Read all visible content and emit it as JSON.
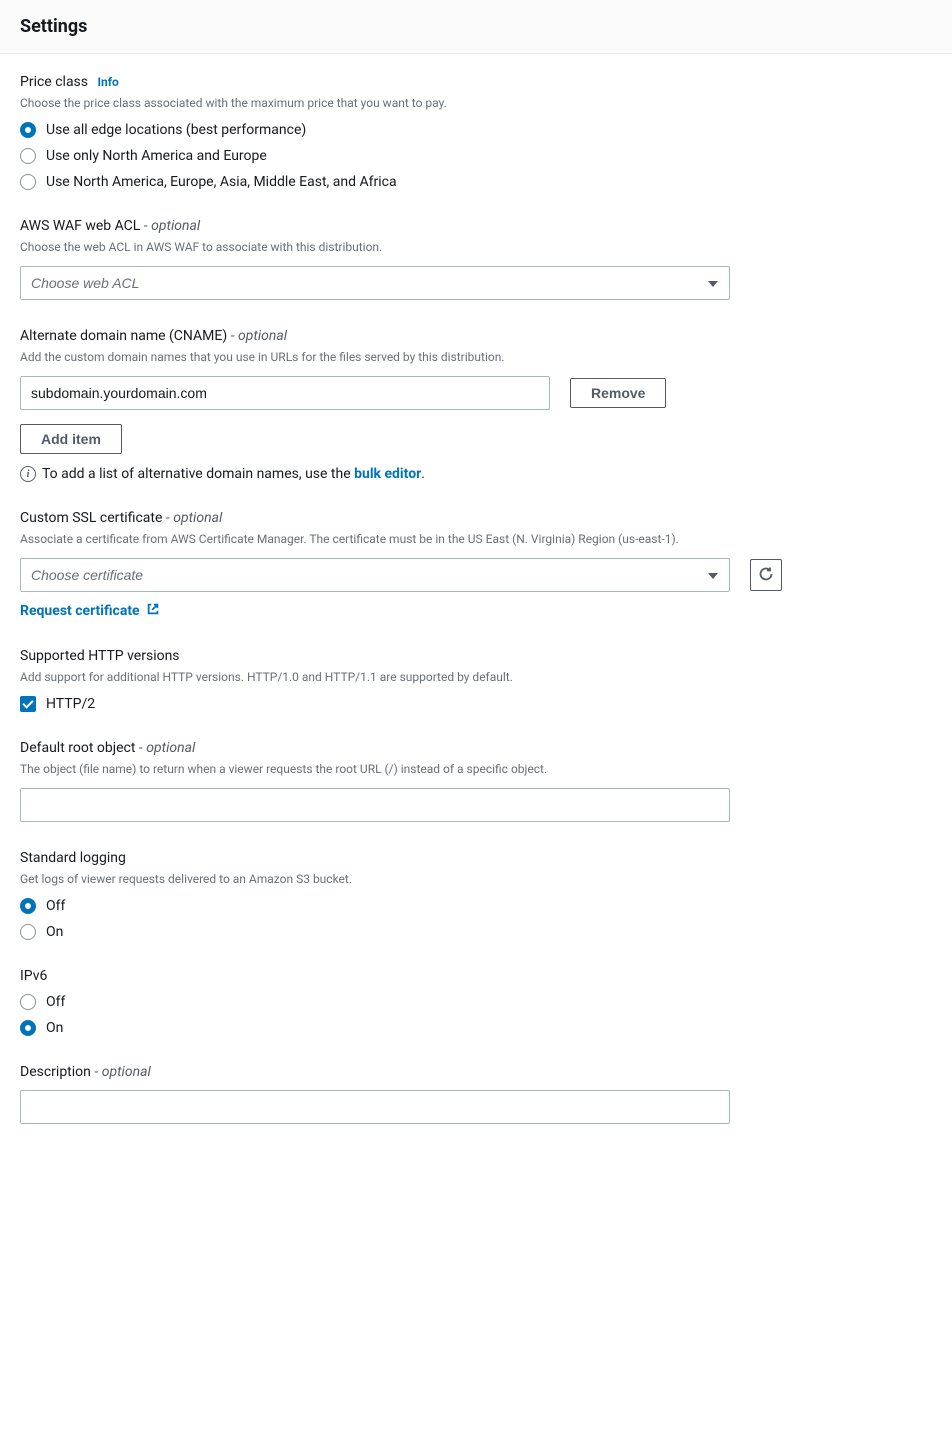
{
  "header": {
    "title": "Settings"
  },
  "priceClass": {
    "label": "Price class",
    "infoLink": "Info",
    "description": "Choose the price class associated with the maximum price that you want to pay.",
    "options": [
      {
        "label": "Use all edge locations (best performance)",
        "checked": true
      },
      {
        "label": "Use only North America and Europe",
        "checked": false
      },
      {
        "label": "Use North America, Europe, Asia, Middle East, and Africa",
        "checked": false
      }
    ]
  },
  "wafAcl": {
    "label": "AWS WAF web ACL",
    "optional": "optional",
    "description": "Choose the web ACL in AWS WAF to associate with this distribution.",
    "placeholder": "Choose web ACL"
  },
  "cname": {
    "label": "Alternate domain name (CNAME)",
    "optional": "optional",
    "description": "Add the custom domain names that you use in URLs for the files served by this distribution.",
    "value": "subdomain.yourdomain.com",
    "removeLabel": "Remove",
    "addItemLabel": "Add item",
    "infoText": "To add a list of alternative domain names, use the ",
    "bulkEditorLink": "bulk editor",
    "period": "."
  },
  "sslCert": {
    "label": "Custom SSL certificate",
    "optional": "optional",
    "description": "Associate a certificate from AWS Certificate Manager. The certificate must be in the US East (N. Virginia) Region (us-east-1).",
    "placeholder": "Choose certificate",
    "requestLink": "Request certificate"
  },
  "httpVersions": {
    "label": "Supported HTTP versions",
    "description": "Add support for additional HTTP versions. HTTP/1.0 and HTTP/1.1 are supported by default.",
    "option": "HTTP/2"
  },
  "rootObject": {
    "label": "Default root object",
    "optional": "optional",
    "description": "The object (file name) to return when a viewer requests the root URL (/) instead of a specific object."
  },
  "logging": {
    "label": "Standard logging",
    "description": "Get logs of viewer requests delivered to an Amazon S3 bucket.",
    "options": [
      {
        "label": "Off",
        "checked": true
      },
      {
        "label": "On",
        "checked": false
      }
    ]
  },
  "ipv6": {
    "label": "IPv6",
    "options": [
      {
        "label": "Off",
        "checked": false
      },
      {
        "label": "On",
        "checked": true
      }
    ]
  },
  "descriptionField": {
    "label": "Description",
    "optional": "optional"
  }
}
